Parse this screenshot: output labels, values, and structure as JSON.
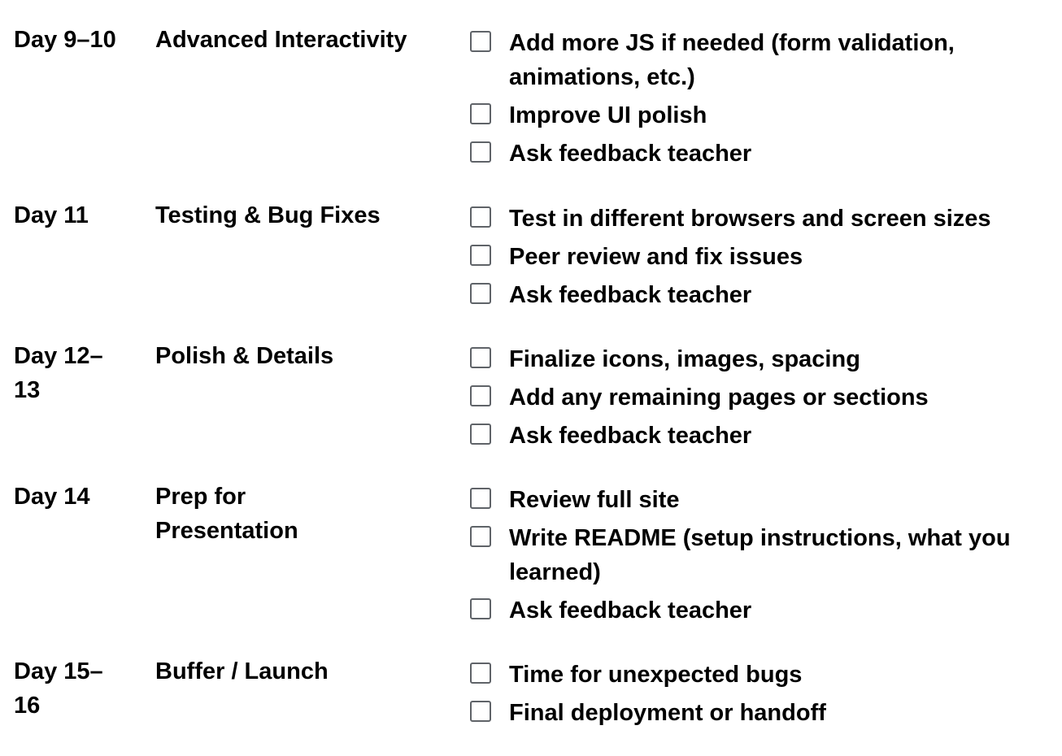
{
  "rows": [
    {
      "day": "Day 9–10",
      "phase": "Advanced Interactivity",
      "tasks": [
        {
          "label": "Add more JS if needed (form validation, animations, etc.)",
          "checked": false
        },
        {
          "label": "Improve UI polish",
          "checked": false
        },
        {
          "label": "Ask feedback teacher",
          "checked": false
        }
      ]
    },
    {
      "day": "Day 11",
      "phase": "Testing & Bug Fixes",
      "tasks": [
        {
          "label": "Test in different browsers and screen sizes",
          "checked": false
        },
        {
          "label": "Peer review and fix issues",
          "checked": false
        },
        {
          "label": "Ask feedback teacher",
          "checked": false
        }
      ]
    },
    {
      "day": "Day 12–13",
      "phase": "Polish & Details",
      "tasks": [
        {
          "label": "Finalize icons, images, spacing",
          "checked": false
        },
        {
          "label": "Add any remaining pages or sections",
          "checked": false
        },
        {
          "label": "Ask feedback teacher",
          "checked": false
        }
      ]
    },
    {
      "day": "Day 14",
      "phase": "Prep for Presentation",
      "tasks": [
        {
          "label": "Review full site",
          "checked": false
        },
        {
          "label": "Write README (setup instructions, what you learned)",
          "checked": false
        },
        {
          "label": "Ask feedback teacher",
          "checked": false
        }
      ]
    },
    {
      "day": "Day 15–16",
      "phase": "Buffer / Launch",
      "tasks": [
        {
          "label": "Time for unexpected bugs",
          "checked": false
        },
        {
          "label": "Final deployment or handoff",
          "checked": false
        }
      ]
    }
  ],
  "icons": {
    "checkbox": "checkbox-icon"
  },
  "colors": {
    "text": "#000000",
    "checkbox_border": "#5f6368"
  }
}
